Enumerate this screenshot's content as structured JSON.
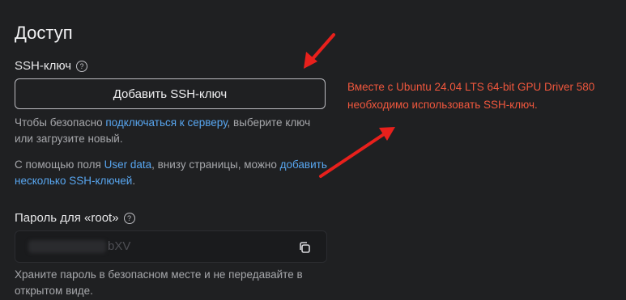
{
  "section_title": "Доступ",
  "ssh": {
    "label": "SSH-ключ",
    "help_symbol": "?",
    "add_button_label": "Добавить SSH-ключ",
    "hint1_before": "Чтобы безопасно ",
    "hint1_link": "подключаться к серверу",
    "hint1_after": ", выберите ключ или загрузите новый.",
    "hint2_before": "С помощью поля ",
    "hint2_link1": "User data",
    "hint2_middle": ", внизу страницы, можно ",
    "hint2_link2": "добавить несколько SSH-ключей",
    "hint2_after": "."
  },
  "notice": {
    "line1": "Вместе с Ubuntu 24.04 LTS 64-bit GPU Driver 580",
    "line2": "необходимо использовать SSH-ключ."
  },
  "password": {
    "label": "Пароль для «root»",
    "help_symbol": "?",
    "visible_value": "bXV",
    "hint": "Храните пароль в безопасном месте и не передавайте в открытом виде."
  },
  "colors": {
    "background": "#1f2022",
    "link": "#58a6f0",
    "annotation": "#f0573d",
    "arrow": "#e8201c"
  },
  "icons": [
    "help-icon",
    "copy-icon",
    "annotation-arrow"
  ]
}
